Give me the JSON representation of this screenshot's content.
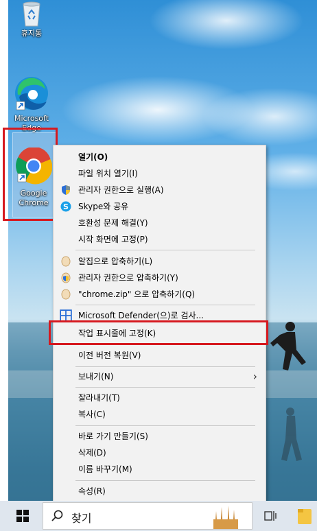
{
  "desktop": {
    "icons": [
      {
        "label": "휴지통",
        "icon": "recycle-bin-icon"
      },
      {
        "label_line1": "Microsoft",
        "label_line2": "Edge",
        "icon": "edge-icon"
      },
      {
        "label_line1": "Google",
        "label_line2": "Chrome",
        "icon": "chrome-icon",
        "selected": true
      }
    ]
  },
  "context_menu": {
    "items": [
      {
        "label": "열기(O)",
        "bold": true
      },
      {
        "label": "파일 위치 열기(I)"
      },
      {
        "label": "관리자 권한으로 실행(A)",
        "icon": "uac-shield-icon"
      },
      {
        "label": "Skype와 공유",
        "icon": "skype-icon"
      },
      {
        "label": "호환성 문제 해결(Y)"
      },
      {
        "label": "시작 화면에 고정(P)"
      },
      {
        "label": "알집으로 압축하기(L)",
        "icon": "alzip-icon"
      },
      {
        "label": "관리자 권한으로 압축하기(Y)",
        "icon": "alzip-shield-icon"
      },
      {
        "label": "\"chrome.zip\" 으로 압축하기(Q)",
        "icon": "alzip-icon"
      },
      {
        "label": "Microsoft Defender(으)로 검사...",
        "icon": "defender-icon"
      },
      {
        "label": "작업 표시줄에 고정(K)",
        "highlighted": true
      },
      {
        "label": "이전 버전 복원(V)"
      },
      {
        "label": "보내기(N)",
        "submenu": true
      },
      {
        "label": "잘라내기(T)"
      },
      {
        "label": "복사(C)"
      },
      {
        "label": "바로 가기 만들기(S)"
      },
      {
        "label": "삭제(D)"
      },
      {
        "label": "이름 바꾸기(M)"
      },
      {
        "label": "속성(R)"
      }
    ]
  },
  "taskbar": {
    "search_text": "찾기",
    "icons": [
      "windows-start-icon",
      "search-icon",
      "task-view-icon",
      "file-explorer-icon"
    ]
  },
  "colors": {
    "highlight_box": "#d6191f",
    "menu_bg": "#f2f2f2"
  }
}
